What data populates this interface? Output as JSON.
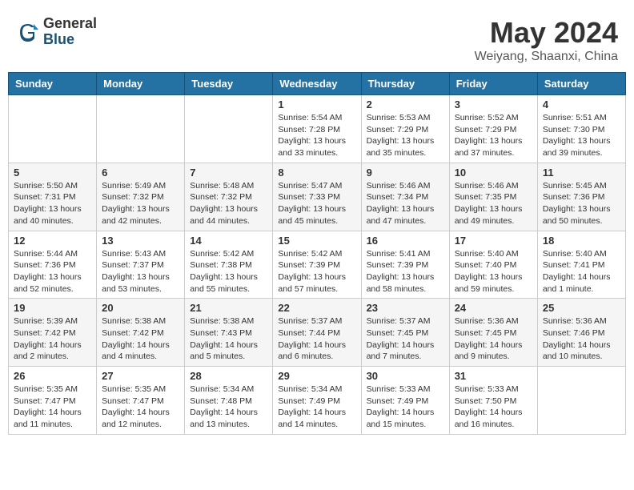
{
  "logo": {
    "general": "General",
    "blue": "Blue"
  },
  "title": {
    "month_year": "May 2024",
    "location": "Weiyang, Shaanxi, China"
  },
  "weekdays": [
    "Sunday",
    "Monday",
    "Tuesday",
    "Wednesday",
    "Thursday",
    "Friday",
    "Saturday"
  ],
  "weeks": [
    [
      {
        "day": "",
        "sunrise": "",
        "sunset": "",
        "daylight": ""
      },
      {
        "day": "",
        "sunrise": "",
        "sunset": "",
        "daylight": ""
      },
      {
        "day": "",
        "sunrise": "",
        "sunset": "",
        "daylight": ""
      },
      {
        "day": "1",
        "sunrise": "Sunrise: 5:54 AM",
        "sunset": "Sunset: 7:28 PM",
        "daylight": "Daylight: 13 hours and 33 minutes."
      },
      {
        "day": "2",
        "sunrise": "Sunrise: 5:53 AM",
        "sunset": "Sunset: 7:29 PM",
        "daylight": "Daylight: 13 hours and 35 minutes."
      },
      {
        "day": "3",
        "sunrise": "Sunrise: 5:52 AM",
        "sunset": "Sunset: 7:29 PM",
        "daylight": "Daylight: 13 hours and 37 minutes."
      },
      {
        "day": "4",
        "sunrise": "Sunrise: 5:51 AM",
        "sunset": "Sunset: 7:30 PM",
        "daylight": "Daylight: 13 hours and 39 minutes."
      }
    ],
    [
      {
        "day": "5",
        "sunrise": "Sunrise: 5:50 AM",
        "sunset": "Sunset: 7:31 PM",
        "daylight": "Daylight: 13 hours and 40 minutes."
      },
      {
        "day": "6",
        "sunrise": "Sunrise: 5:49 AM",
        "sunset": "Sunset: 7:32 PM",
        "daylight": "Daylight: 13 hours and 42 minutes."
      },
      {
        "day": "7",
        "sunrise": "Sunrise: 5:48 AM",
        "sunset": "Sunset: 7:32 PM",
        "daylight": "Daylight: 13 hours and 44 minutes."
      },
      {
        "day": "8",
        "sunrise": "Sunrise: 5:47 AM",
        "sunset": "Sunset: 7:33 PM",
        "daylight": "Daylight: 13 hours and 45 minutes."
      },
      {
        "day": "9",
        "sunrise": "Sunrise: 5:46 AM",
        "sunset": "Sunset: 7:34 PM",
        "daylight": "Daylight: 13 hours and 47 minutes."
      },
      {
        "day": "10",
        "sunrise": "Sunrise: 5:46 AM",
        "sunset": "Sunset: 7:35 PM",
        "daylight": "Daylight: 13 hours and 49 minutes."
      },
      {
        "day": "11",
        "sunrise": "Sunrise: 5:45 AM",
        "sunset": "Sunset: 7:36 PM",
        "daylight": "Daylight: 13 hours and 50 minutes."
      }
    ],
    [
      {
        "day": "12",
        "sunrise": "Sunrise: 5:44 AM",
        "sunset": "Sunset: 7:36 PM",
        "daylight": "Daylight: 13 hours and 52 minutes."
      },
      {
        "day": "13",
        "sunrise": "Sunrise: 5:43 AM",
        "sunset": "Sunset: 7:37 PM",
        "daylight": "Daylight: 13 hours and 53 minutes."
      },
      {
        "day": "14",
        "sunrise": "Sunrise: 5:42 AM",
        "sunset": "Sunset: 7:38 PM",
        "daylight": "Daylight: 13 hours and 55 minutes."
      },
      {
        "day": "15",
        "sunrise": "Sunrise: 5:42 AM",
        "sunset": "Sunset: 7:39 PM",
        "daylight": "Daylight: 13 hours and 57 minutes."
      },
      {
        "day": "16",
        "sunrise": "Sunrise: 5:41 AM",
        "sunset": "Sunset: 7:39 PM",
        "daylight": "Daylight: 13 hours and 58 minutes."
      },
      {
        "day": "17",
        "sunrise": "Sunrise: 5:40 AM",
        "sunset": "Sunset: 7:40 PM",
        "daylight": "Daylight: 13 hours and 59 minutes."
      },
      {
        "day": "18",
        "sunrise": "Sunrise: 5:40 AM",
        "sunset": "Sunset: 7:41 PM",
        "daylight": "Daylight: 14 hours and 1 minute."
      }
    ],
    [
      {
        "day": "19",
        "sunrise": "Sunrise: 5:39 AM",
        "sunset": "Sunset: 7:42 PM",
        "daylight": "Daylight: 14 hours and 2 minutes."
      },
      {
        "day": "20",
        "sunrise": "Sunrise: 5:38 AM",
        "sunset": "Sunset: 7:42 PM",
        "daylight": "Daylight: 14 hours and 4 minutes."
      },
      {
        "day": "21",
        "sunrise": "Sunrise: 5:38 AM",
        "sunset": "Sunset: 7:43 PM",
        "daylight": "Daylight: 14 hours and 5 minutes."
      },
      {
        "day": "22",
        "sunrise": "Sunrise: 5:37 AM",
        "sunset": "Sunset: 7:44 PM",
        "daylight": "Daylight: 14 hours and 6 minutes."
      },
      {
        "day": "23",
        "sunrise": "Sunrise: 5:37 AM",
        "sunset": "Sunset: 7:45 PM",
        "daylight": "Daylight: 14 hours and 7 minutes."
      },
      {
        "day": "24",
        "sunrise": "Sunrise: 5:36 AM",
        "sunset": "Sunset: 7:45 PM",
        "daylight": "Daylight: 14 hours and 9 minutes."
      },
      {
        "day": "25",
        "sunrise": "Sunrise: 5:36 AM",
        "sunset": "Sunset: 7:46 PM",
        "daylight": "Daylight: 14 hours and 10 minutes."
      }
    ],
    [
      {
        "day": "26",
        "sunrise": "Sunrise: 5:35 AM",
        "sunset": "Sunset: 7:47 PM",
        "daylight": "Daylight: 14 hours and 11 minutes."
      },
      {
        "day": "27",
        "sunrise": "Sunrise: 5:35 AM",
        "sunset": "Sunset: 7:47 PM",
        "daylight": "Daylight: 14 hours and 12 minutes."
      },
      {
        "day": "28",
        "sunrise": "Sunrise: 5:34 AM",
        "sunset": "Sunset: 7:48 PM",
        "daylight": "Daylight: 14 hours and 13 minutes."
      },
      {
        "day": "29",
        "sunrise": "Sunrise: 5:34 AM",
        "sunset": "Sunset: 7:49 PM",
        "daylight": "Daylight: 14 hours and 14 minutes."
      },
      {
        "day": "30",
        "sunrise": "Sunrise: 5:33 AM",
        "sunset": "Sunset: 7:49 PM",
        "daylight": "Daylight: 14 hours and 15 minutes."
      },
      {
        "day": "31",
        "sunrise": "Sunrise: 5:33 AM",
        "sunset": "Sunset: 7:50 PM",
        "daylight": "Daylight: 14 hours and 16 minutes."
      },
      {
        "day": "",
        "sunrise": "",
        "sunset": "",
        "daylight": ""
      }
    ]
  ]
}
